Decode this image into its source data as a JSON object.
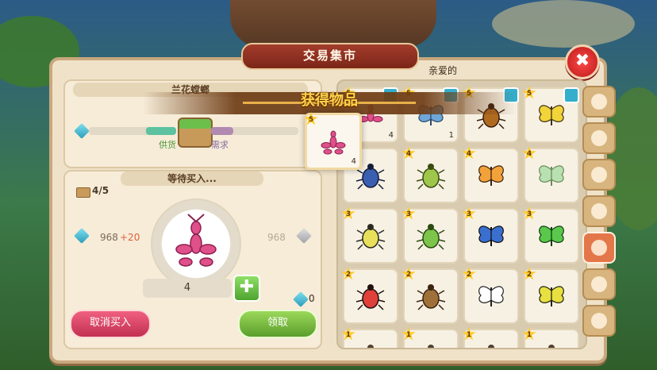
{
  "window": {
    "title": "交易集市",
    "close_icon": "✖"
  },
  "left_top": {
    "item_name": "兰花螳螂",
    "supply_label": "供货",
    "demand_label": "需求",
    "supply_fraction": 0.35,
    "demand_fraction": 0.25
  },
  "left_bottom": {
    "status_title": "等待买入...",
    "capacity": "4/5",
    "price_value": "968",
    "price_delta": "+20",
    "price_right": "968",
    "quantity": "4",
    "plus_label": "✚",
    "owned_count": "0"
  },
  "buttons": {
    "cancel_buy": "取消买入",
    "collect": "领取"
  },
  "grid": {
    "header": "亲爱的",
    "rows": [
      [
        {
          "stars": "5",
          "count": "4",
          "cube": true,
          "insect": "orchid-mantis"
        },
        {
          "stars": "5",
          "count": "1",
          "cube": true,
          "insect": "blue-butterfly"
        },
        {
          "stars": "5",
          "count": "",
          "cube": true,
          "insect": "stag-beetle"
        },
        {
          "stars": "5",
          "count": "",
          "cube": true,
          "insect": "yellow-butterfly"
        }
      ],
      [
        {
          "stars": "4",
          "count": "",
          "cube": false,
          "insect": "blue-beetle"
        },
        {
          "stars": "4",
          "count": "",
          "cube": false,
          "insect": "green-beetle"
        },
        {
          "stars": "4",
          "count": "",
          "cube": false,
          "insect": "monarch-butterfly"
        },
        {
          "stars": "4",
          "count": "",
          "cube": false,
          "insect": "luna-moth"
        }
      ],
      [
        {
          "stars": "3",
          "count": "",
          "cube": false,
          "insect": "firefly"
        },
        {
          "stars": "3",
          "count": "",
          "cube": false,
          "insect": "scarab-beetle"
        },
        {
          "stars": "3",
          "count": "",
          "cube": false,
          "insect": "blue-black-butterfly"
        },
        {
          "stars": "3",
          "count": "",
          "cube": false,
          "insect": "green-swallowtail"
        }
      ],
      [
        {
          "stars": "2",
          "count": "",
          "cube": false,
          "insect": "ladybug"
        },
        {
          "stars": "2",
          "count": "",
          "cube": false,
          "insect": "cricket"
        },
        {
          "stars": "2",
          "count": "",
          "cube": false,
          "insect": "white-butterfly"
        },
        {
          "stars": "2",
          "count": "",
          "cube": false,
          "insect": "yellow-black-butterfly"
        }
      ],
      [
        {
          "stars": "1",
          "count": "",
          "cube": false,
          "insect": "insect"
        },
        {
          "stars": "1",
          "count": "",
          "cube": false,
          "insect": "insect"
        },
        {
          "stars": "1",
          "count": "",
          "cube": false,
          "insect": "insect"
        },
        {
          "stars": "1",
          "count": "",
          "cube": false,
          "insect": "insect"
        }
      ]
    ]
  },
  "side_tabs": [
    {
      "name": "wheat-tab-icon",
      "active": false
    },
    {
      "name": "grain-tab-icon",
      "active": false
    },
    {
      "name": "flower-tab-icon",
      "active": false
    },
    {
      "name": "fish-tab-icon",
      "active": false
    },
    {
      "name": "beetle-tab-icon",
      "active": true
    },
    {
      "name": "shell-tab-icon",
      "active": false
    },
    {
      "name": "misc-tab-icon",
      "active": false
    }
  ],
  "popup": {
    "title": "获得物品",
    "stars": "5",
    "count": "4",
    "insect": "orchid-mantis"
  },
  "colors": {
    "accent_red": "#c23050",
    "accent_green": "#5a9e2c",
    "gold": "#ffd24a",
    "panel": "#efe2c8"
  }
}
